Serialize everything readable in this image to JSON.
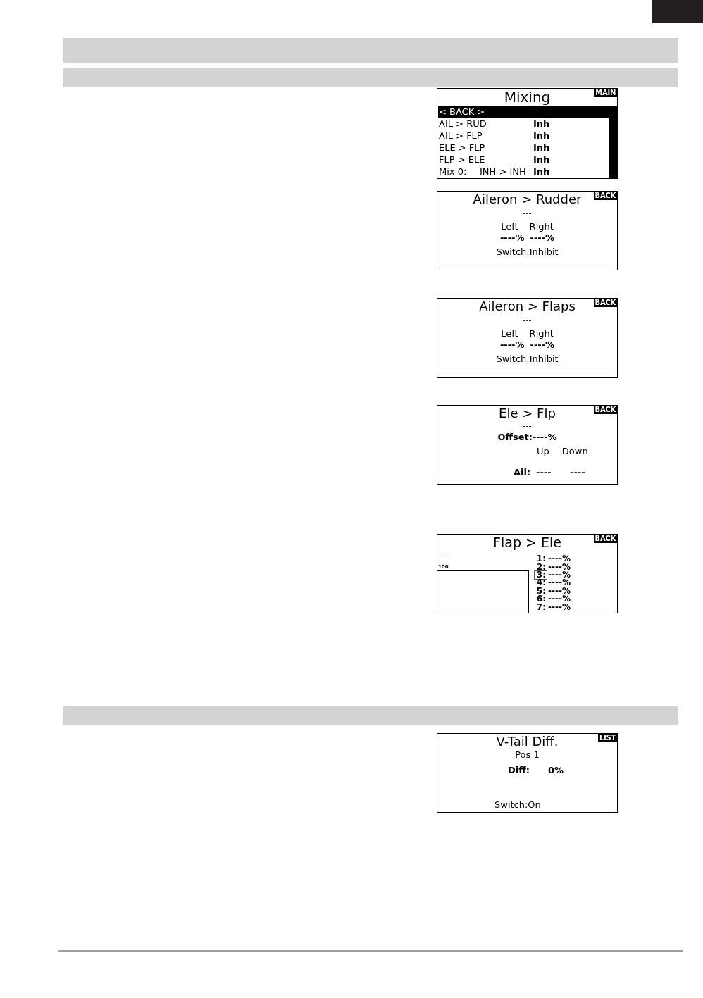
{
  "sections": [
    {
      "screens": [
        {
          "kind": "menu",
          "title": "Mixing",
          "tag": "MAIN",
          "rows": [
            {
              "label": "< BACK >",
              "selected": true
            },
            {
              "label": "AIL > RUD",
              "value": "Inh",
              "selected": false
            },
            {
              "label": "AIL > FLP",
              "value": "Inh",
              "selected": false
            },
            {
              "label": "ELE > FLP",
              "value": "Inh",
              "selected": false
            },
            {
              "label": "FLP > ELE",
              "value": "Inh",
              "selected": false
            },
            {
              "label": "Mix 0:",
              "mix": "INH > INH",
              "value": "Inh",
              "selected": false
            }
          ]
        },
        {
          "kind": "mix_rate",
          "title": "Aileron > Rudder",
          "tag": "BACK",
          "subtitle": "---",
          "columns": [
            "Left",
            "Right"
          ],
          "values": [
            "----%",
            "----%"
          ],
          "switch": "Switch:Inhibit"
        },
        {
          "kind": "mix_rate",
          "title": "Aileron > Flaps",
          "tag": "BACK",
          "subtitle": "---",
          "columns": [
            "Left",
            "Right"
          ],
          "values": [
            "----%",
            "----%"
          ],
          "switch": "Switch:Inhibit"
        },
        {
          "kind": "offset_mix",
          "title": "Ele > Flp",
          "tag": "BACK",
          "subtitle": "---",
          "offset": "Offset:----%",
          "columns": [
            "Up",
            "Down"
          ],
          "row_label": "Ail:",
          "values": [
            "----",
            "----"
          ]
        },
        {
          "kind": "curve_mix",
          "title": "Flap > Ele",
          "tag": "BACK",
          "subtitle": "---",
          "axis_label": "100",
          "points": [
            {
              "label": "1:",
              "value": "----%",
              "selected": false
            },
            {
              "label": "2:",
              "value": "----%",
              "selected": false
            },
            {
              "label": "3:",
              "value": "----%",
              "selected": true
            },
            {
              "label": "4:",
              "value": "----%",
              "selected": false
            },
            {
              "label": "5:",
              "value": "----%",
              "selected": false
            },
            {
              "label": "6:",
              "value": "----%",
              "selected": false
            },
            {
              "label": "7:",
              "value": "----%",
              "selected": false
            }
          ]
        }
      ]
    },
    {
      "screens": [
        {
          "kind": "differential",
          "title": "V-Tail Diff.",
          "tag": "LIST",
          "subtitle": "Pos 1",
          "label": "Diff:",
          "value": "0%",
          "switch": "Switch:On"
        }
      ]
    }
  ]
}
